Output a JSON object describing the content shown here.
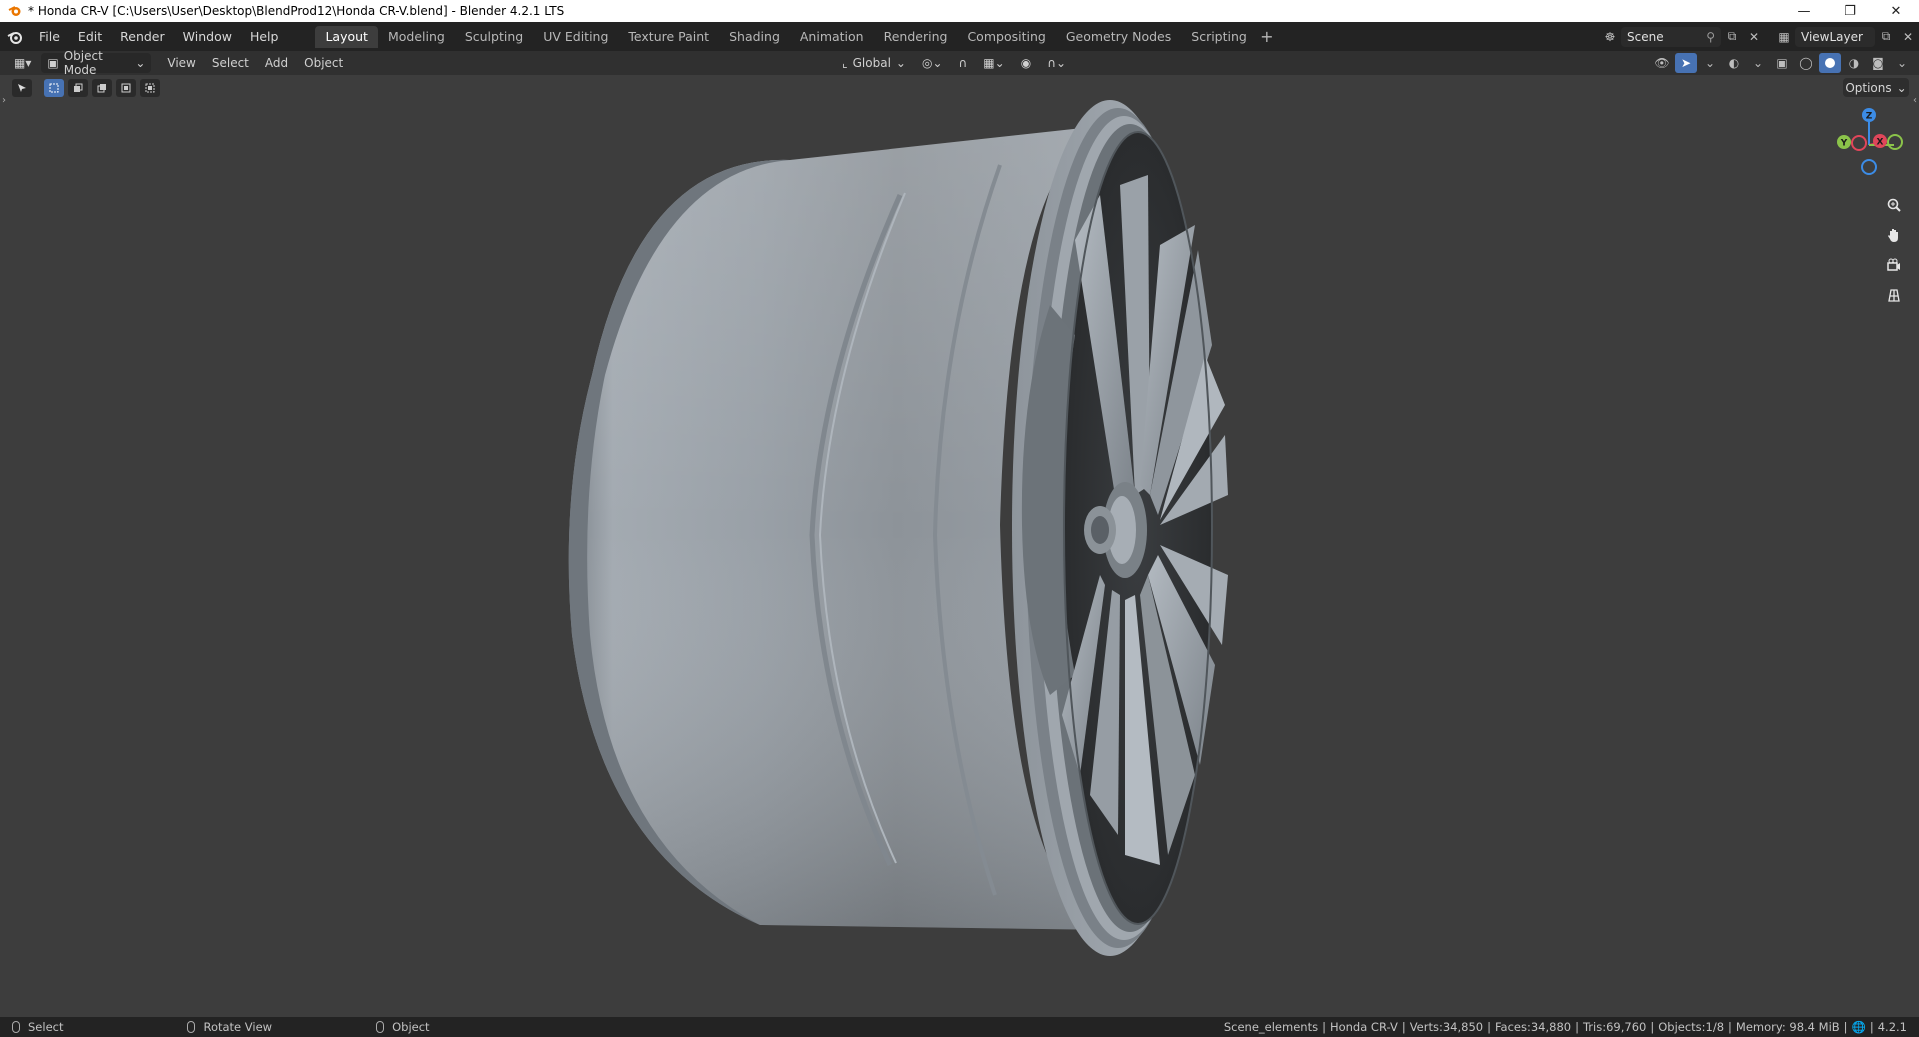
{
  "window": {
    "title": "* Honda CR-V [C:\\Users\\User\\Desktop\\BlendProd12\\Honda CR-V.blend] - Blender 4.2.1 LTS",
    "controls": [
      "minimize",
      "restore",
      "close"
    ]
  },
  "menubar": {
    "items": [
      "File",
      "Edit",
      "Render",
      "Window",
      "Help"
    ]
  },
  "workspaces": {
    "tabs": [
      "Layout",
      "Modeling",
      "Sculpting",
      "UV Editing",
      "Texture Paint",
      "Shading",
      "Animation",
      "Rendering",
      "Compositing",
      "Geometry Nodes",
      "Scripting"
    ],
    "active": "Layout",
    "add_label": "+"
  },
  "scene": {
    "name": "Scene",
    "view_layer": "ViewLayer"
  },
  "viewport_header": {
    "mode": "Object Mode",
    "menus": [
      "View",
      "Select",
      "Add",
      "Object"
    ],
    "transform_orientation": "Global",
    "options_label": "Options"
  },
  "gizmo": {
    "x": "X",
    "y": "Y",
    "z": "Z"
  },
  "statusbar": {
    "hints": [
      "Select",
      "Rotate View",
      "Object"
    ],
    "collection": "Scene_elements",
    "object": "Honda CR-V",
    "verts": "Verts:34,850",
    "faces": "Faces:34,880",
    "tris": "Tris:69,760",
    "objects": "Objects:1/8",
    "memory": "Memory: 98.4 MiB",
    "version": "4.2.1"
  },
  "colors": {
    "accent": "#4772b3",
    "axis_x": "#e0465a",
    "axis_y": "#8bc34a",
    "axis_z": "#3c8ce6"
  }
}
